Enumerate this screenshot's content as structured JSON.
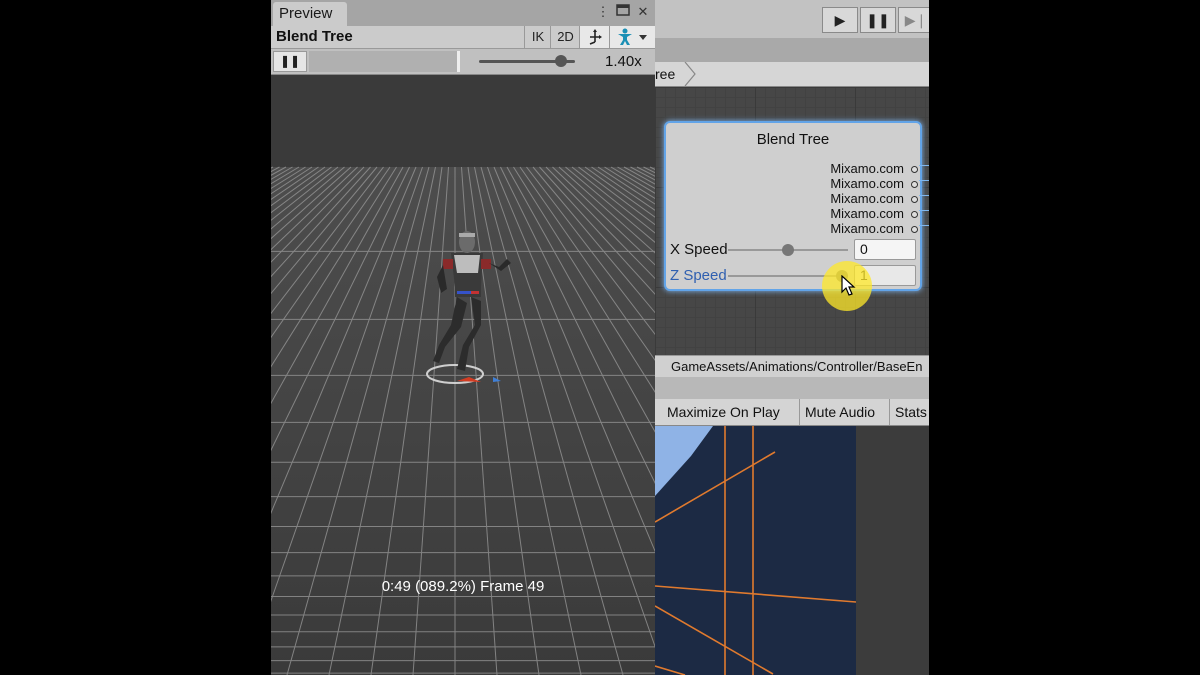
{
  "preview": {
    "tab_label": "Preview",
    "menu_icon": "more-vert-icon",
    "maximize_icon": "maximize-icon",
    "close_icon": "close-icon",
    "title": "Blend Tree",
    "ik_label": "IK",
    "two_d_label": "2D",
    "pivot_icon": "pivot-icon",
    "avatar_icon": "avatar-icon",
    "pause_icon": "pause-icon",
    "speed_label": "1.40x",
    "speed_level": 0.85,
    "frame_label": "0:49 (089.2%) Frame 49"
  },
  "toolbar": {
    "play_icon": "play-icon",
    "pause_icon": "pause-icon",
    "step_icon": "step-icon"
  },
  "animator": {
    "breadcrumb": "ree",
    "node": {
      "title": "Blend Tree",
      "motions": [
        "Mixamo.com",
        "Mixamo.com",
        "Mixamo.com",
        "Mixamo.com",
        "Mixamo.com"
      ],
      "params": [
        {
          "label": "X Speed",
          "value": "0",
          "slider": 0.5
        },
        {
          "label": "Z Speed",
          "value": "1",
          "slider": 1.0
        }
      ]
    },
    "path": "GameAssets/Animations/Controller/BaseEn"
  },
  "game": {
    "maximize_label": "Maximize On Play",
    "mute_label": "Mute Audio",
    "stats_label": "Stats"
  },
  "colors": {
    "node_border": "#62a4e8",
    "cursor_highlight": "#ffe828",
    "z_speed_label": "#2f5fb0",
    "game_grid": "#e07a2e"
  }
}
